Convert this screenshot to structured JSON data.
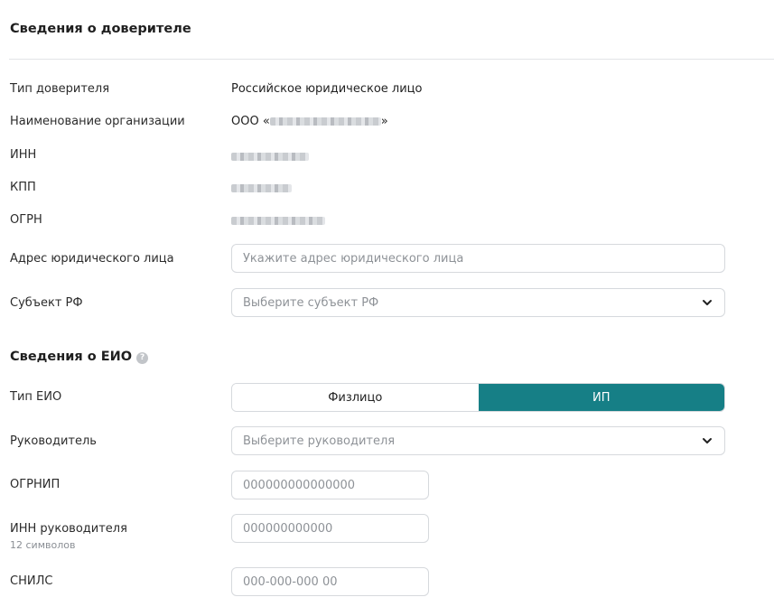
{
  "principal_section": {
    "title": "Сведения о доверителе",
    "fields": [
      {
        "label": "Тип доверителя",
        "value": "Российское юридическое лицо"
      },
      {
        "label": "Наименование организации",
        "value_prefix": "ООО «",
        "value_suffix": "»"
      },
      {
        "label": "ИНН"
      },
      {
        "label": "КПП"
      },
      {
        "label": "ОГРН"
      }
    ],
    "address": {
      "label": "Адрес юридического лица",
      "placeholder": "Укажите адрес юридического лица"
    },
    "region": {
      "label": "Субъект РФ",
      "placeholder": "Выберите субъект РФ"
    }
  },
  "eio_section": {
    "title": "Сведения о ЕИО",
    "type": {
      "label": "Тип ЕИО",
      "options": [
        "Физлицо",
        "ИП"
      ],
      "selected": "ИП"
    },
    "head": {
      "label": "Руководитель",
      "placeholder": "Выберите руководителя"
    },
    "ogrnip": {
      "label": "ОГРНИП",
      "placeholder": "000000000000000"
    },
    "inn_head": {
      "label": "ИНН руководителя",
      "hint": "12 символов",
      "placeholder": "000000000000"
    },
    "snils": {
      "label": "СНИЛС",
      "placeholder": "000-000-000 00"
    }
  },
  "colors": {
    "accent": "#167f86",
    "border": "#d6d9dd",
    "divider": "#e2e4e7"
  },
  "icons": {
    "help": "question-circle-icon",
    "chevron": "chevron-down-icon"
  }
}
